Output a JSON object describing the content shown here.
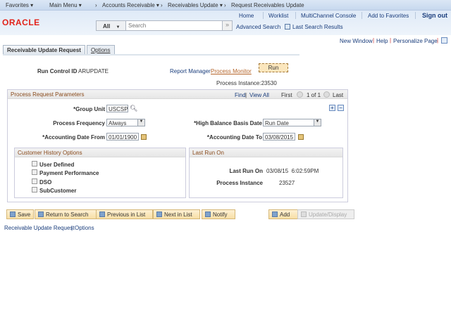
{
  "topbar": {
    "favorites": "Favorites ▾",
    "main_menu": "Main Menu ▾",
    "breadcrumbs": [
      "Accounts Receivable ▾",
      "Receivables Update ▾",
      "Request Receivables Update"
    ]
  },
  "header": {
    "logo": "ORACLE",
    "links": [
      "Home",
      "Worklist",
      "MultiChannel Console",
      "Add to Favorites",
      "Sign out"
    ],
    "search": {
      "scope": "All",
      "placeholder": "Search"
    },
    "advanced_search": "Advanced Search",
    "last_search_results": "Last Search Results"
  },
  "pagebar": {
    "new_window": "New Window",
    "help": "Help",
    "personalize": "Personalize Page"
  },
  "tabs": [
    "Receivable Update Request",
    "Options"
  ],
  "run": {
    "run_control_label": "Run Control ID",
    "run_control_value": "ARUPDATE",
    "report_manager": "Report Manager",
    "process_monitor": "Process Monitor",
    "run_button": "Run",
    "process_instance": "Process Instance:23530"
  },
  "params": {
    "title": "Process Request Parameters",
    "find": "Find",
    "view_all": "View All",
    "first": "First",
    "count": "1 of 1",
    "last": "Last",
    "group_unit_label": "*Group Unit",
    "group_unit_value": "USCSP",
    "frequency_label": "Process Frequency",
    "frequency_value": "Always",
    "hb_label": "*High Balance Basis Date",
    "hb_value": "Run Date",
    "date_from_label": "*Accounting Date From",
    "date_from_value": "01/01/1900",
    "date_to_label": "*Accounting Date To",
    "date_to_value": "03/08/2015"
  },
  "history": {
    "title": "Customer History Options",
    "options": [
      {
        "label": "User Defined",
        "checked": false
      },
      {
        "label": "Payment Performance",
        "checked": false
      },
      {
        "label": "DSO",
        "checked": false
      },
      {
        "label": "SubCustomer",
        "checked": false
      }
    ]
  },
  "last_run": {
    "title": "Last Run On",
    "last_run_label": "Last Run On",
    "last_run_value": "03/08/15  6:02:59PM",
    "instance_label": "Process Instance",
    "instance_value": "23527"
  },
  "buttons": {
    "save": "Save",
    "return": "Return to Search",
    "previous": "Previous in List",
    "next": "Next in List",
    "notify": "Notify",
    "add": "Add",
    "update": "Update/Display"
  },
  "footer": {
    "link1": "Receivable Update Request",
    "link2": "Options"
  }
}
